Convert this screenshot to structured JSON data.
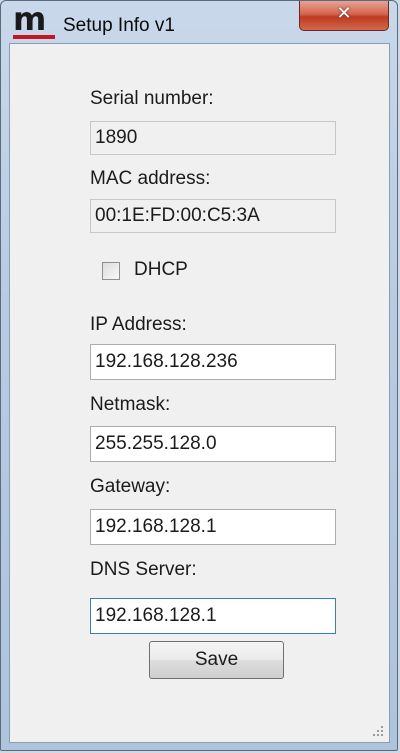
{
  "window": {
    "title": "Setup Info v1",
    "close_glyph": "✕",
    "logo_letter": "m",
    "logo_icon": "app-logo-icon"
  },
  "form": {
    "serial_label": "Serial number:",
    "serial_value": "1890",
    "mac_label": "MAC address:",
    "mac_value": "00:1E:FD:00:C5:3A",
    "dhcp_label": "DHCP",
    "dhcp_checked": false,
    "ip_label": "IP Address:",
    "ip_value": "192.168.128.236",
    "netmask_label": "Netmask:",
    "netmask_value": "255.255.128.0",
    "gateway_label": "Gateway:",
    "gateway_value": "192.168.128.1",
    "dns_label": "DNS Server:",
    "dns_value": "192.168.128.1",
    "save_label": "Save"
  },
  "colors": {
    "logo_accent": "#c0181e",
    "close_button": "#c0391f",
    "focus_border": "#3c7fb1"
  }
}
